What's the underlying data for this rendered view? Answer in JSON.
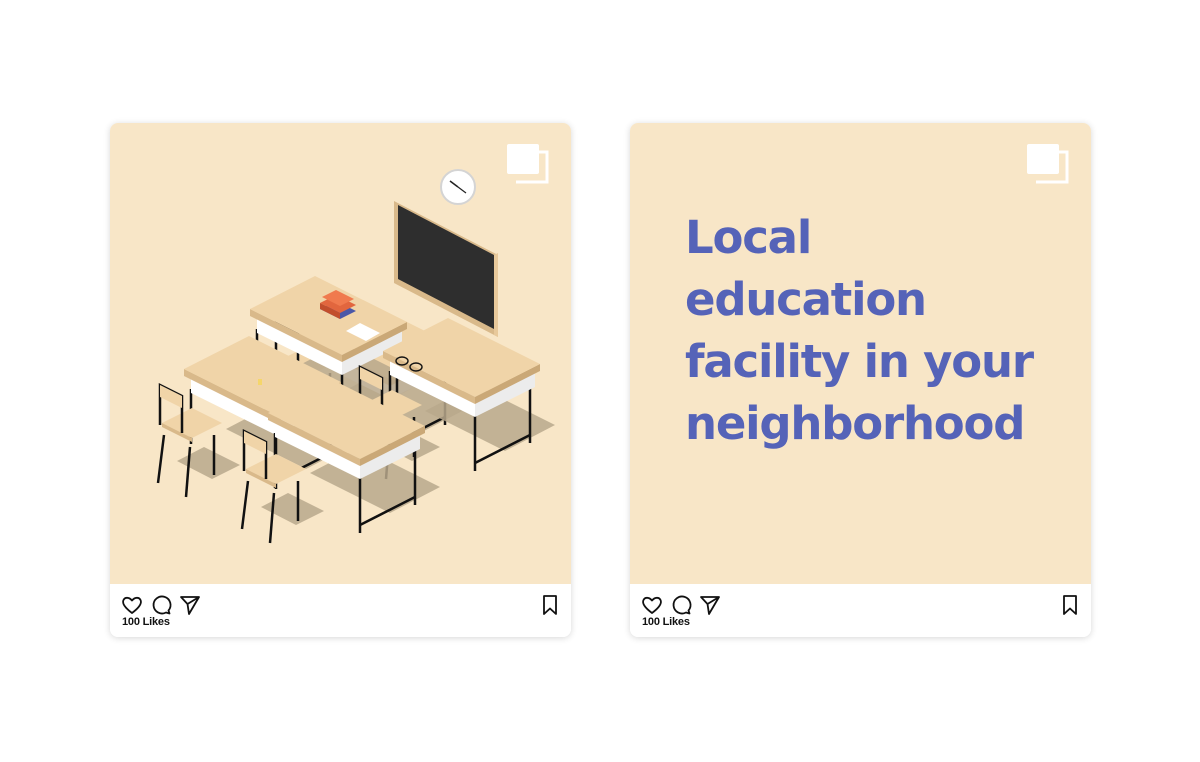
{
  "colors": {
    "card_bg": "#f8e6c7",
    "headline": "#5563b8",
    "icon_stroke": "#111111"
  },
  "posts": [
    {
      "media": "classroom-illustration",
      "multi_image_icon": "carousel-icon",
      "actions": [
        "heart-icon",
        "comment-icon",
        "share-icon",
        "bookmark-icon"
      ],
      "likes": "100 Likes"
    },
    {
      "media": "text-card",
      "multi_image_icon": "carousel-icon",
      "headline_lines": [
        "Local",
        "education",
        "facility in your",
        "neighborhood"
      ],
      "actions": [
        "heart-icon",
        "comment-icon",
        "share-icon",
        "bookmark-icon"
      ],
      "likes": "100 Likes"
    }
  ]
}
